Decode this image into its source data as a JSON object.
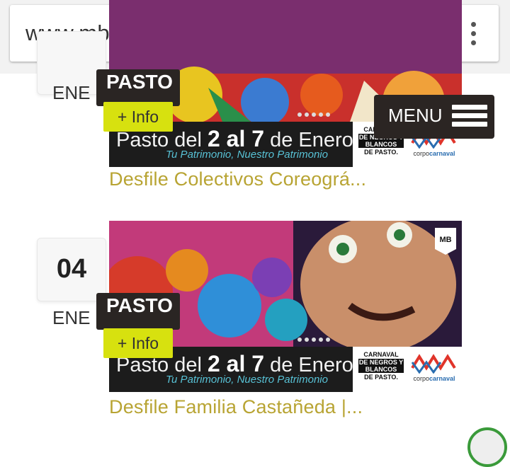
{
  "browser": {
    "url": "www.mb-network.com"
  },
  "menu": {
    "label": "MENU"
  },
  "events": [
    {
      "month": "ENE",
      "city": "PASTO",
      "info_label": "+ Info",
      "banner_line": "Pasto del",
      "banner_dates": "2 al 7",
      "banner_month": "de Enero",
      "banner_tagline": "Tu Patrimonio, Nuestro Patrimonio",
      "title": "Desfile Colectivos Coreográ..."
    },
    {
      "day": "04",
      "month": "ENE",
      "city": "PASTO",
      "info_label": "+ Info",
      "banner_line": "Pasto del",
      "banner_dates": "2 al 7",
      "banner_month": "de Enero",
      "banner_tagline": "Tu Patrimonio, Nuestro Patrimonio",
      "title": "Desfile Familia Castañeda |..."
    }
  ],
  "logos": {
    "carnaval_top": "CARNAVAL",
    "carnaval_mid": "DE NEGROS Y BLANCOS",
    "carnaval_bottom": "DE PASTO.",
    "corpo_a": "corpo",
    "corpo_b": "carnaval",
    "watermark": "MB"
  }
}
